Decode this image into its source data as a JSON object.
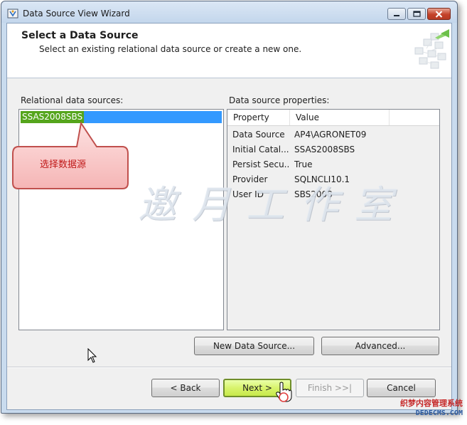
{
  "window": {
    "title": "Data Source View Wizard"
  },
  "header": {
    "title": "Select a Data Source",
    "subtitle": "Select an existing relational data source or create a new one."
  },
  "relational": {
    "label": "Relational data sources:",
    "items": [
      "SSAS2008SBS"
    ]
  },
  "annotation": {
    "callout_text": "选择数据源",
    "watermark_text": "邀月工作室"
  },
  "properties": {
    "label": "Data source properties:",
    "columns": [
      "Property",
      "Value"
    ],
    "rows": [
      {
        "property": "Data Source",
        "value": "AP4\\AGRONET09"
      },
      {
        "property": "Initial Catal...",
        "value": "SSAS2008SBS"
      },
      {
        "property": "Persist Secu...",
        "value": "True"
      },
      {
        "property": "Provider",
        "value": "SQLNCLI10.1"
      },
      {
        "property": "User ID",
        "value": "SBS2008"
      }
    ]
  },
  "buttons": {
    "new_data_source": "New Data Source...",
    "advanced": "Advanced...",
    "back": "< Back",
    "next": "Next >",
    "finish": "Finish >>|",
    "cancel": "Cancel"
  },
  "site_watermark": {
    "line1": "织梦内容管理系统",
    "line2": "DEDECMS.COM"
  },
  "colors": {
    "selection": "#3399ff",
    "selection_text_bg": "#55a51c",
    "callout_fill": "#f9c9c9",
    "callout_text": "#c01818",
    "next_button": "#d8f36c"
  }
}
